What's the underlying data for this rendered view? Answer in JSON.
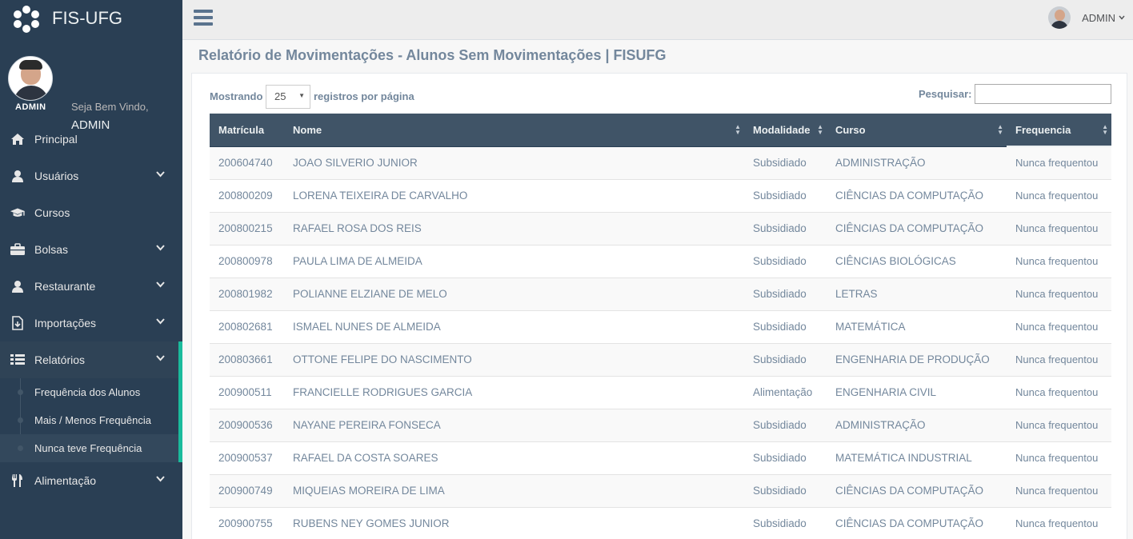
{
  "app": {
    "title": "FIS-UFG"
  },
  "profile": {
    "welcome": "Seja Bem Vindo,",
    "name": "ADMIN",
    "role": "ADMIN"
  },
  "sidebar": {
    "items": [
      {
        "label": "Principal",
        "icon": "home-icon",
        "chevron": false
      },
      {
        "label": "Usuários",
        "icon": "user-icon",
        "chevron": true
      },
      {
        "label": "Cursos",
        "icon": "graduation-cap-icon",
        "chevron": false
      },
      {
        "label": "Bolsas",
        "icon": "briefcase-icon",
        "chevron": true
      },
      {
        "label": "Restaurante",
        "icon": "user-icon",
        "chevron": true
      },
      {
        "label": "Importações",
        "icon": "file-import-icon",
        "chevron": true
      },
      {
        "label": "Relatórios",
        "icon": "table-list-icon",
        "chevron": true,
        "active": true
      },
      {
        "label": "Alimentação",
        "icon": "cutlery-icon",
        "chevron": true
      }
    ],
    "submenu": [
      {
        "label": "Frequência dos Alunos"
      },
      {
        "label": "Mais / Menos Frequência"
      },
      {
        "label": "Nunca teve Frequência",
        "current": true
      }
    ]
  },
  "topnav": {
    "user": "ADMIN"
  },
  "page": {
    "title": "Relatório de Movimentações - Alunos Sem Movimentações | FISUFG"
  },
  "controls": {
    "show_label": "Mostrando",
    "page_size": "25",
    "per_page_label": "registros por página",
    "search_label": "Pesquisar:",
    "search_value": ""
  },
  "table": {
    "headers": [
      "Matrícula",
      "Nome",
      "Modalidade",
      "Curso",
      "Frequencia"
    ],
    "rows": [
      [
        "200604740",
        "JOAO SILVERIO JUNIOR",
        "Subsidiado",
        "ADMINISTRAÇÃO",
        "Nunca frequentou"
      ],
      [
        "200800209",
        "LORENA TEIXEIRA DE CARVALHO",
        "Subsidiado",
        "CIÊNCIAS DA COMPUTAÇÃO",
        "Nunca frequentou"
      ],
      [
        "200800215",
        "RAFAEL ROSA DOS REIS",
        "Subsidiado",
        "CIÊNCIAS DA COMPUTAÇÃO",
        "Nunca frequentou"
      ],
      [
        "200800978",
        "PAULA LIMA DE ALMEIDA",
        "Subsidiado",
        "CIÊNCIAS BIOLÓGICAS",
        "Nunca frequentou"
      ],
      [
        "200801982",
        "POLIANNE ELZIANE DE MELO",
        "Subsidiado",
        "LETRAS",
        "Nunca frequentou"
      ],
      [
        "200802681",
        "ISMAEL NUNES DE ALMEIDA",
        "Subsidiado",
        "MATEMÁTICA",
        "Nunca frequentou"
      ],
      [
        "200803661",
        "OTTONE FELIPE DO NASCIMENTO",
        "Subsidiado",
        "ENGENHARIA DE PRODUÇÃO",
        "Nunca frequentou"
      ],
      [
        "200900511",
        "FRANCIELLE RODRIGUES GARCIA",
        "Alimentação",
        "ENGENHARIA CIVIL",
        "Nunca frequentou"
      ],
      [
        "200900536",
        "NAYANE PEREIRA FONSECA",
        "Subsidiado",
        "ADMINISTRAÇÃO",
        "Nunca frequentou"
      ],
      [
        "200900537",
        "RAFAEL DA COSTA SOARES",
        "Subsidiado",
        "MATEMÁTICA INDUSTRIAL",
        "Nunca frequentou"
      ],
      [
        "200900749",
        "MIQUEIAS MOREIRA DE LIMA",
        "Subsidiado",
        "CIÊNCIAS DA COMPUTAÇÃO",
        "Nunca frequentou"
      ],
      [
        "200900755",
        "RUBENS NEY GOMES JUNIOR",
        "Subsidiado",
        "CIÊNCIAS DA COMPUTAÇÃO",
        "Nunca frequentou"
      ]
    ]
  },
  "colors": {
    "sidebar_bg": "#2a3f54",
    "accent": "#1abb9c",
    "header_bg": "#405467"
  }
}
